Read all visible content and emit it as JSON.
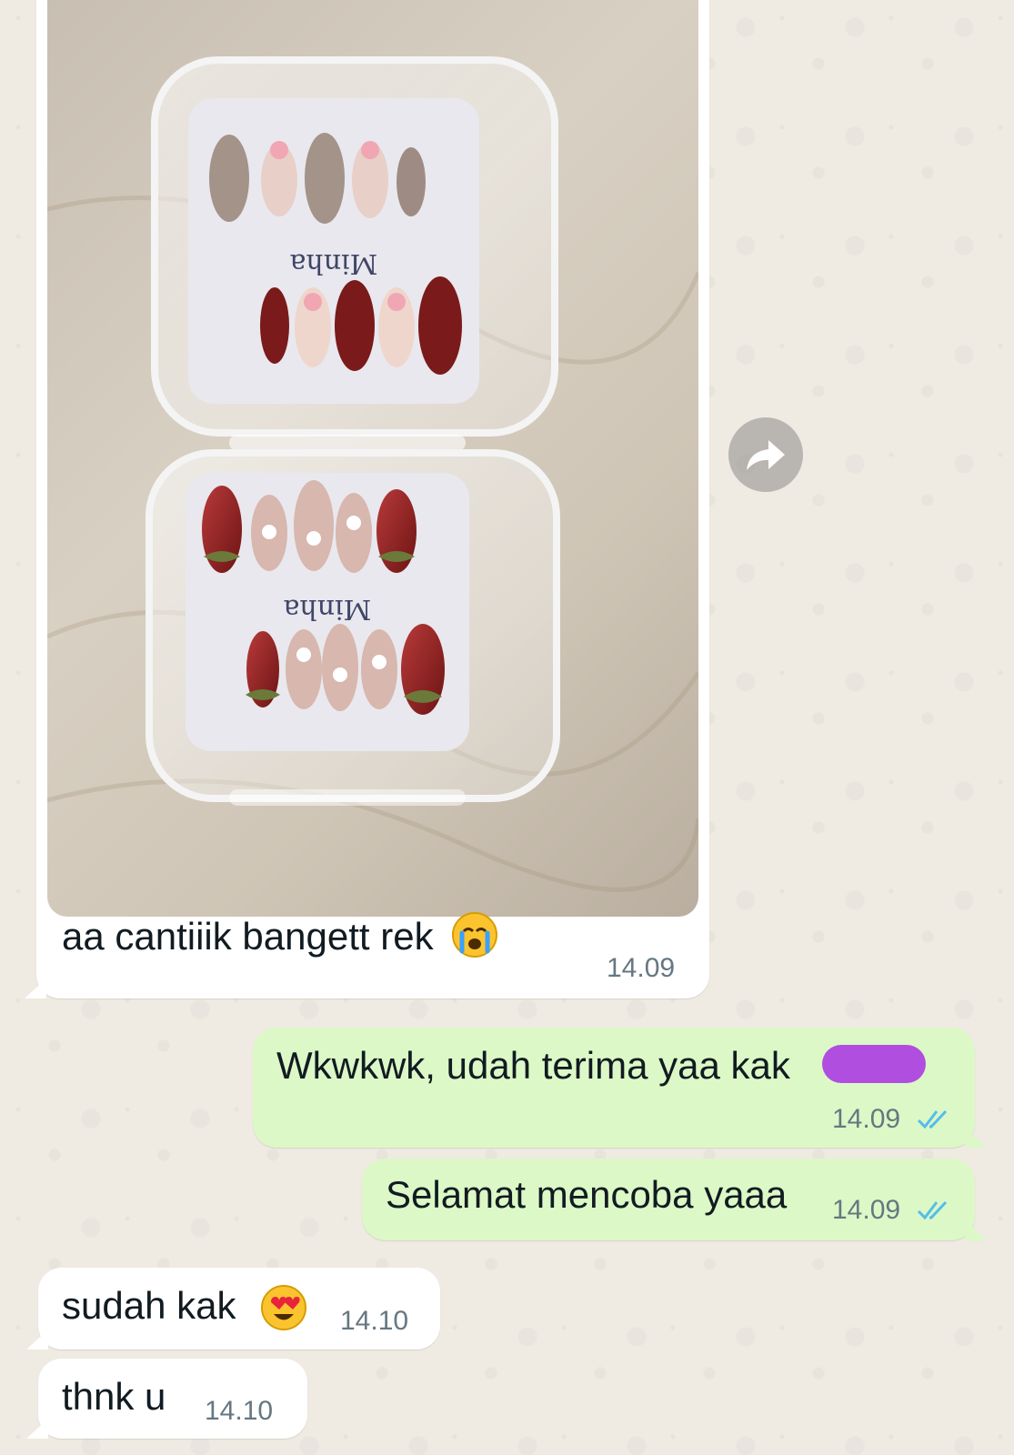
{
  "messages": [
    {
      "id": "photo-msg",
      "direction": "incoming",
      "caption": "aa cantiiik bangett rek",
      "time": "14.09",
      "photo": {
        "brand_top": "Minha",
        "brand_bottom": "Minha"
      }
    },
    {
      "id": "reply-1",
      "direction": "outgoing",
      "text": "Wkwkwk, udah terima yaa kak",
      "time": "14.09",
      "status": "read"
    },
    {
      "id": "reply-2",
      "direction": "outgoing",
      "text": "Selamat mencoba yaaa",
      "time": "14.09",
      "status": "read"
    },
    {
      "id": "reply-3",
      "direction": "incoming",
      "text": "sudah kak",
      "time": "14.10"
    },
    {
      "id": "reply-4",
      "direction": "incoming",
      "text": "thnk u",
      "time": "14.10"
    }
  ],
  "icons": {
    "forward": "forward-icon",
    "crying_emoji": "crying-face-emoji",
    "heart_eyes_emoji": "heart-eyes-emoji",
    "read_ticks": "double-check-icon"
  },
  "colors": {
    "background": "#efeae2",
    "incoming_bubble": "#ffffff",
    "outgoing_bubble": "#dcf8c6",
    "read_ticks": "#53bdeb",
    "redaction": "#b04ee0"
  }
}
